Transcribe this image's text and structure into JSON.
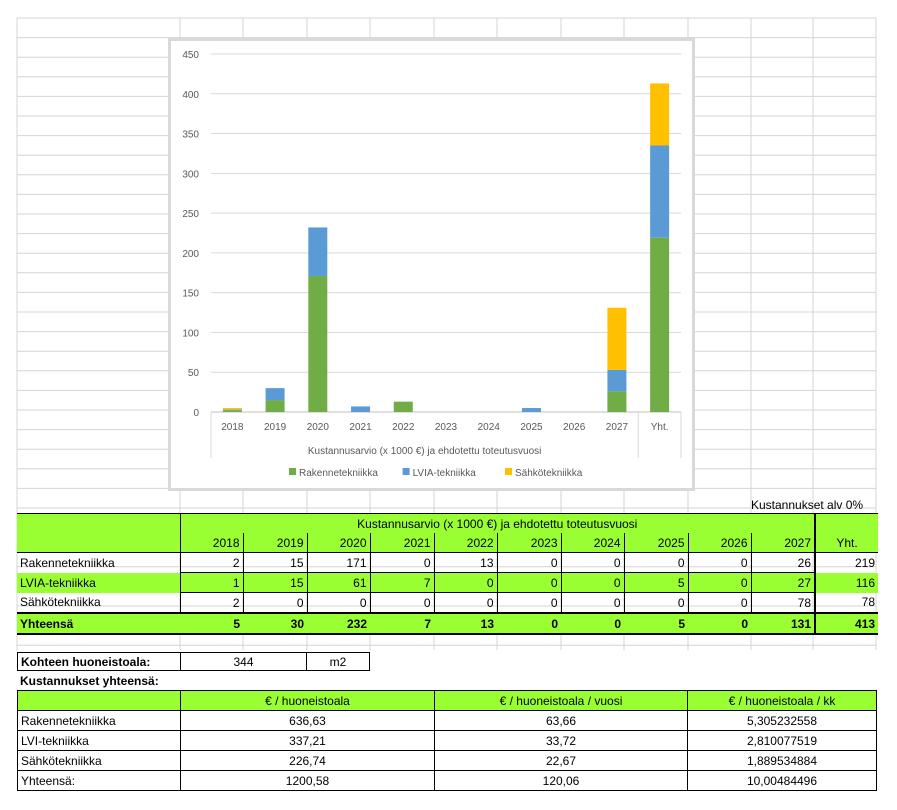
{
  "chart_data": {
    "type": "bar",
    "stacked": true,
    "categories": [
      "2018",
      "2019",
      "2020",
      "2021",
      "2022",
      "2023",
      "2024",
      "2025",
      "2026",
      "2027",
      "Yht."
    ],
    "series": [
      {
        "name": "Rakennetekniikka",
        "color": "#70ad47",
        "values": [
          2,
          15,
          171,
          0,
          13,
          0,
          0,
          0,
          0,
          26,
          219
        ]
      },
      {
        "name": "LVIA-tekniikka",
        "color": "#5b9bd5",
        "values": [
          1,
          15,
          61,
          7,
          0,
          0,
          0,
          5,
          0,
          27,
          116
        ]
      },
      {
        "name": "Sähkötekniikka",
        "color": "#ffc000",
        "values": [
          2,
          0,
          0,
          0,
          0,
          0,
          0,
          0,
          0,
          78,
          78
        ]
      }
    ],
    "yticks": [
      0,
      50,
      100,
      150,
      200,
      250,
      300,
      350,
      400,
      450
    ],
    "ylim": [
      0,
      450
    ],
    "xlabel": "Kustannusarvio (x 1000 €) ja ehdotettu toteutusvuosi",
    "legend_position": "bottom",
    "grid": true
  },
  "note_alv": "Kustannukset alv 0%",
  "cost_table": {
    "header_title": "Kustannusarvio (x 1000 €) ja ehdotettu toteutusvuosi",
    "years": [
      "2018",
      "2019",
      "2020",
      "2021",
      "2022",
      "2023",
      "2024",
      "2025",
      "2026",
      "2027"
    ],
    "total_header": "Yht.",
    "rows": [
      {
        "label": "Rakennetekniikka",
        "values": [
          "2",
          "15",
          "171",
          "0",
          "13",
          "0",
          "0",
          "0",
          "0",
          "26"
        ],
        "total": "219"
      },
      {
        "label": "LVIA-tekniikka",
        "values": [
          "1",
          "15",
          "61",
          "7",
          "0",
          "0",
          "0",
          "5",
          "0",
          "27"
        ],
        "total": "116"
      },
      {
        "label": "Sähkötekniikka",
        "values": [
          "2",
          "0",
          "0",
          "0",
          "0",
          "0",
          "0",
          "0",
          "0",
          "78"
        ],
        "total": "78"
      }
    ],
    "sum": {
      "label": "Yhteensä",
      "values": [
        "5",
        "30",
        "232",
        "7",
        "13",
        "0",
        "0",
        "5",
        "0",
        "131"
      ],
      "total": "413"
    }
  },
  "area": {
    "label": "Kohteen huoneistoala:",
    "value": "344",
    "unit": "m2"
  },
  "summary": {
    "title": "Kustannukset yhteensä:",
    "headers": [
      "€ / huoneistoala",
      "€ / huoneistoala / vuosi",
      "€ / huoneistoala / kk"
    ],
    "rows": [
      {
        "label": "Rakennetekniikka",
        "values": [
          "636,63",
          "63,66",
          "5,305232558"
        ]
      },
      {
        "label": "LVI-tekniikka",
        "values": [
          "337,21",
          "33,72",
          "2,810077519"
        ]
      },
      {
        "label": "Sähkötekniikka",
        "values": [
          "226,74",
          "22,67",
          "1,889534884"
        ]
      },
      {
        "label": "Yhteensä:",
        "values": [
          "1200,58",
          "120,06",
          "10,00484496"
        ]
      }
    ]
  }
}
